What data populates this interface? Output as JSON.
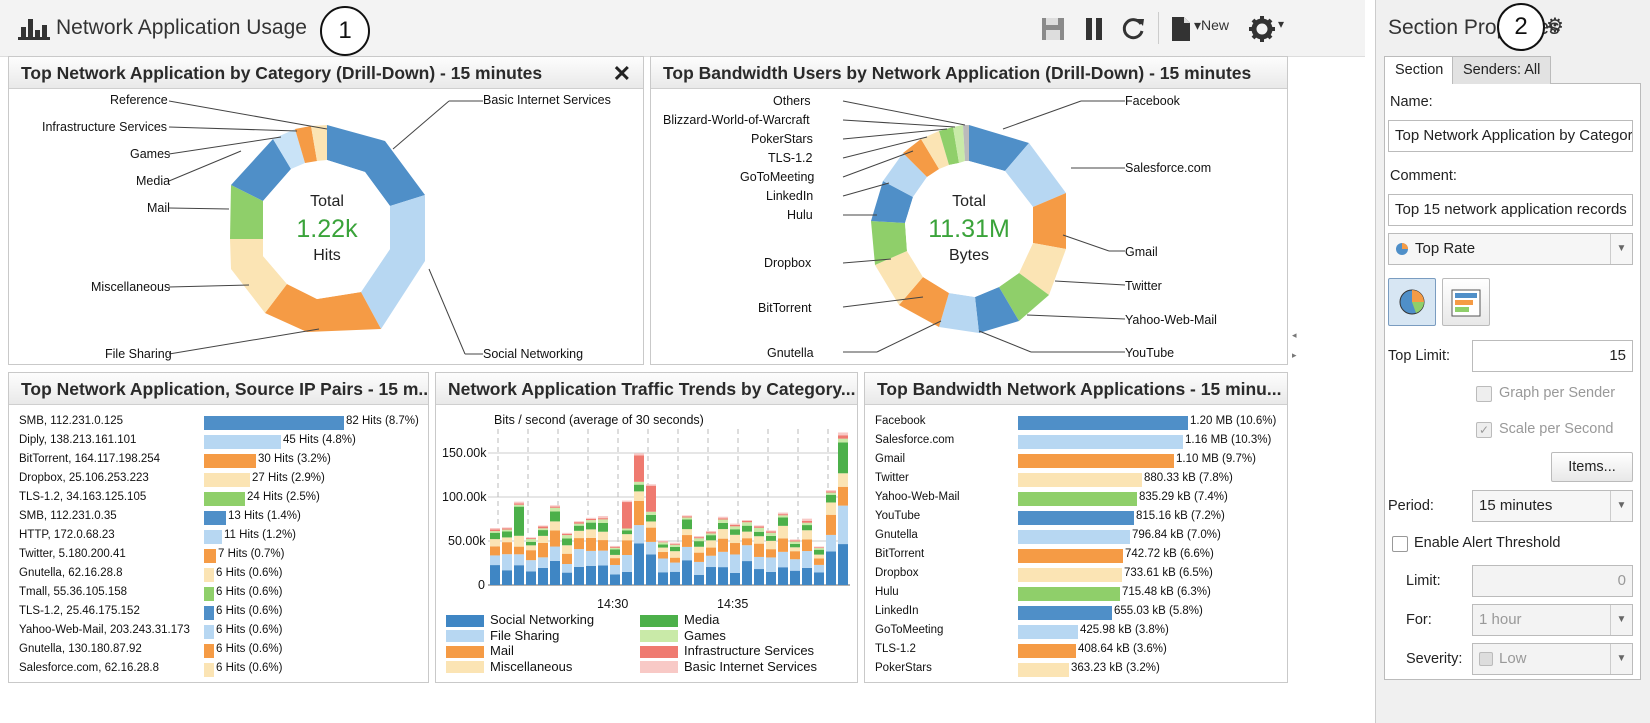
{
  "header": {
    "title": "Network Application Usage",
    "callout_1": "1",
    "callout_2": "2",
    "new_label": "New"
  },
  "panels": {
    "category": {
      "title": "Top Network Application by Category (Drill-Down) - 15 minutes",
      "close": "✕",
      "center_top": "Total",
      "center_value": "1.22k",
      "center_unit": "Hits",
      "labels": [
        "Reference",
        "Infrastructure Services",
        "Games",
        "Media",
        "Mail",
        "Miscellaneous",
        "File Sharing",
        "Basic Internet Services",
        "Social Networking"
      ]
    },
    "users": {
      "title": "Top Bandwidth Users by Network Application (Drill-Down) - 15 minutes",
      "center_top": "Total",
      "center_value": "11.31M",
      "center_unit": "Bytes",
      "labels_left": [
        "Others",
        "Blizzard-World-of-Warcraft",
        "PokerStars",
        "TLS-1.2",
        "GoToMeeting",
        "LinkedIn",
        "Hulu",
        "Dropbox",
        "BitTorrent",
        "Gnutella"
      ],
      "labels_right": [
        "Facebook",
        "Salesforce.com",
        "Gmail",
        "Twitter",
        "Yahoo-Web-Mail",
        "YouTube"
      ]
    },
    "pairs": {
      "title": "Top Network Application, Source IP Pairs - 15 m...",
      "rows": [
        {
          "name": "SMB, 112.231.0.125",
          "value": "82 Hits (8.7%)",
          "pct": 1.0,
          "color": "#4f8fc8"
        },
        {
          "name": "Diply, 138.213.161.101",
          "value": "45 Hits (4.8%)",
          "pct": 0.55,
          "color": "#b7d7f2"
        },
        {
          "name": "BitTorrent, 164.117.198.254",
          "value": "30 Hits (3.2%)",
          "pct": 0.37,
          "color": "#f59b45"
        },
        {
          "name": "Dropbox, 25.106.253.223",
          "value": "27 Hits (2.9%)",
          "pct": 0.33,
          "color": "#fbe4b4"
        },
        {
          "name": "TLS-1.2, 34.163.125.105",
          "value": "24 Hits (2.5%)",
          "pct": 0.29,
          "color": "#8fcf6a"
        },
        {
          "name": "SMB, 112.231.0.35",
          "value": "13 Hits (1.4%)",
          "pct": 0.16,
          "color": "#4f8fc8"
        },
        {
          "name": "HTTP, 172.0.68.23",
          "value": "11 Hits (1.2%)",
          "pct": 0.13,
          "color": "#b7d7f2"
        },
        {
          "name": "Twitter, 5.180.200.41",
          "value": "7 Hits (0.7%)",
          "pct": 0.085,
          "color": "#f59b45"
        },
        {
          "name": "Gnutella, 62.16.28.8",
          "value": "6 Hits (0.6%)",
          "pct": 0.07,
          "color": "#fbe4b4"
        },
        {
          "name": "Tmall, 55.36.105.158",
          "value": "6 Hits (0.6%)",
          "pct": 0.07,
          "color": "#8fcf6a"
        },
        {
          "name": "TLS-1.2, 25.46.175.152",
          "value": "6 Hits (0.6%)",
          "pct": 0.07,
          "color": "#4f8fc8"
        },
        {
          "name": "Yahoo-Web-Mail, 203.243.31.173",
          "value": "6 Hits (0.6%)",
          "pct": 0.07,
          "color": "#b7d7f2"
        },
        {
          "name": "Gnutella, 130.180.87.92",
          "value": "6 Hits (0.6%)",
          "pct": 0.07,
          "color": "#f59b45"
        },
        {
          "name": "Salesforce.com, 62.16.28.8",
          "value": "6 Hits (0.6%)",
          "pct": 0.07,
          "color": "#fbe4b4"
        }
      ]
    },
    "trends": {
      "title": "Network Application Traffic Trends by Category...",
      "subtitle": "Bits / second (average of 30 seconds)",
      "y_ticks": [
        "150.00k",
        "100.00k",
        "50.00k",
        "0"
      ],
      "x_ticks": [
        "14:30",
        "14:35"
      ],
      "legend": [
        {
          "name": "Social Networking",
          "color": "#3f86c4"
        },
        {
          "name": "Media",
          "color": "#4cb04a"
        },
        {
          "name": "File Sharing",
          "color": "#b7d7f2"
        },
        {
          "name": "Games",
          "color": "#c9eaa8"
        },
        {
          "name": "Mail",
          "color": "#f59b45"
        },
        {
          "name": "Infrastructure Services",
          "color": "#ef7a70"
        },
        {
          "name": "Miscellaneous",
          "color": "#fbe4b4"
        },
        {
          "name": "Basic Internet Services",
          "color": "#f8c9c6"
        }
      ]
    },
    "apps": {
      "title": "Top Bandwidth Network Applications - 15 minu...",
      "rows": [
        {
          "name": "Facebook",
          "value": "1.20 MB (10.6%)",
          "pct": 1.0,
          "color": "#4f8fc8"
        },
        {
          "name": "Salesforce.com",
          "value": "1.16 MB (10.3%)",
          "pct": 0.97,
          "color": "#b7d7f2"
        },
        {
          "name": "Gmail",
          "value": "1.10 MB (9.7%)",
          "pct": 0.92,
          "color": "#f59b45"
        },
        {
          "name": "Twitter",
          "value": "880.33 kB (7.8%)",
          "pct": 0.73,
          "color": "#fbe4b4"
        },
        {
          "name": "Yahoo-Web-Mail",
          "value": "835.29 kB (7.4%)",
          "pct": 0.7,
          "color": "#8fcf6a"
        },
        {
          "name": "YouTube",
          "value": "815.16 kB (7.2%)",
          "pct": 0.68,
          "color": "#4f8fc8"
        },
        {
          "name": "Gnutella",
          "value": "796.84 kB (7.0%)",
          "pct": 0.66,
          "color": "#b7d7f2"
        },
        {
          "name": "BitTorrent",
          "value": "742.72 kB (6.6%)",
          "pct": 0.62,
          "color": "#f59b45"
        },
        {
          "name": "Dropbox",
          "value": "733.61 kB (6.5%)",
          "pct": 0.61,
          "color": "#fbe4b4"
        },
        {
          "name": "Hulu",
          "value": "715.48 kB (6.3%)",
          "pct": 0.6,
          "color": "#8fcf6a"
        },
        {
          "name": "LinkedIn",
          "value": "655.03 kB (5.8%)",
          "pct": 0.55,
          "color": "#4f8fc8"
        },
        {
          "name": "GoToMeeting",
          "value": "425.98 kB (3.8%)",
          "pct": 0.355,
          "color": "#b7d7f2"
        },
        {
          "name": "TLS-1.2",
          "value": "408.64 kB (3.6%)",
          "pct": 0.34,
          "color": "#f59b45"
        },
        {
          "name": "PokerStars",
          "value": "363.23 kB (3.2%)",
          "pct": 0.3,
          "color": "#fbe4b4"
        }
      ]
    }
  },
  "sidebar": {
    "title": "Section Properties",
    "tab_section": "Section",
    "tab_senders": "Senders: All",
    "name_label": "Name:",
    "name_value": "Top Network Application by Category",
    "comment_label": "Comment:",
    "comment_value": "Top 15 network application records",
    "rate_value": "Top Rate",
    "top_limit_label": "Top Limit:",
    "top_limit_value": "15",
    "graph_per_sender": "Graph per Sender",
    "scale_per_second": "Scale per Second",
    "items_button": "Items...",
    "period_label": "Period:",
    "period_value": "15 minutes",
    "alert_label": "Enable Alert Threshold",
    "limit_label": "Limit:",
    "limit_value": "0",
    "for_label": "For:",
    "for_value": "1 hour",
    "severity_label": "Severity:",
    "severity_value": "Low"
  }
}
